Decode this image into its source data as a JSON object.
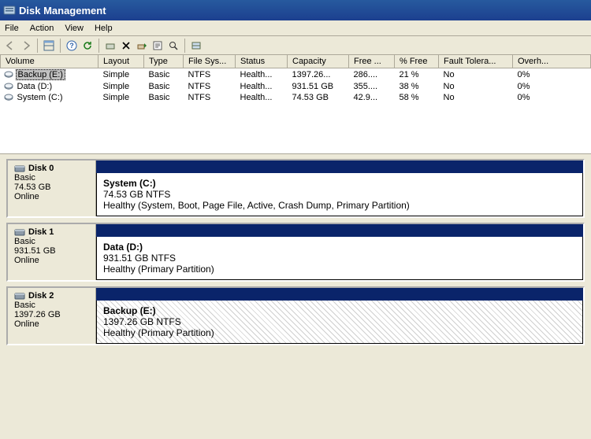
{
  "window": {
    "title": "Disk Management"
  },
  "menubar": {
    "file": "File",
    "action": "Action",
    "view": "View",
    "help": "Help"
  },
  "columns": {
    "volume": "Volume",
    "layout": "Layout",
    "type": "Type",
    "filesys": "File Sys...",
    "status": "Status",
    "capacity": "Capacity",
    "free": "Free ...",
    "pctfree": "% Free",
    "fault": "Fault Tolera...",
    "overhead": "Overh..."
  },
  "volumes": [
    {
      "name": "Backup (E:)",
      "layout": "Simple",
      "type": "Basic",
      "fs": "NTFS",
      "status": "Health...",
      "capacity": "1397.26...",
      "free": "286....",
      "pct": "21 %",
      "fault": "No",
      "over": "0%",
      "selected": true
    },
    {
      "name": "Data (D:)",
      "layout": "Simple",
      "type": "Basic",
      "fs": "NTFS",
      "status": "Health...",
      "capacity": "931.51 GB",
      "free": "355....",
      "pct": "38 %",
      "fault": "No",
      "over": "0%",
      "selected": false
    },
    {
      "name": "System (C:)",
      "layout": "Simple",
      "type": "Basic",
      "fs": "NTFS",
      "status": "Health...",
      "capacity": "74.53 GB",
      "free": "42.9...",
      "pct": "58 %",
      "fault": "No",
      "over": "0%",
      "selected": false
    }
  ],
  "disks": [
    {
      "title": "Disk 0",
      "type": "Basic",
      "size": "74.53 GB",
      "status": "Online",
      "part": {
        "name": "System  (C:)",
        "line2": "74.53 GB NTFS",
        "line3": "Healthy (System, Boot, Page File, Active, Crash Dump, Primary Partition)",
        "hatched": false
      }
    },
    {
      "title": "Disk 1",
      "type": "Basic",
      "size": "931.51 GB",
      "status": "Online",
      "part": {
        "name": "Data  (D:)",
        "line2": "931.51 GB NTFS",
        "line3": "Healthy (Primary Partition)",
        "hatched": false
      }
    },
    {
      "title": "Disk 2",
      "type": "Basic",
      "size": "1397.26 GB",
      "status": "Online",
      "part": {
        "name": "Backup  (E:)",
        "line2": "1397.26 GB NTFS",
        "line3": "Healthy (Primary Partition)",
        "hatched": true
      }
    }
  ]
}
